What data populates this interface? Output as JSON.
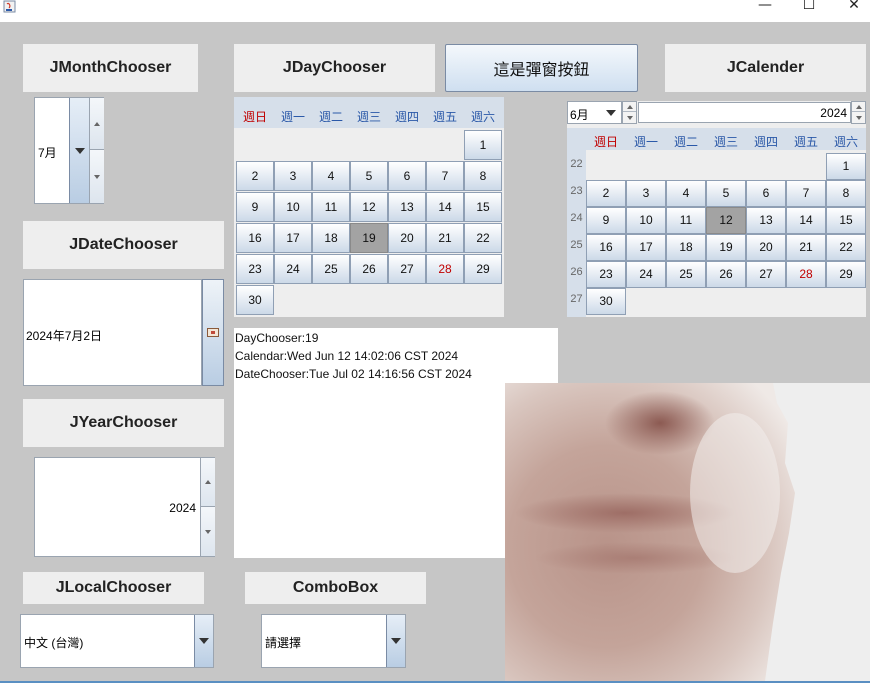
{
  "window": {
    "minimize": "—",
    "maximize": "☐",
    "close": "✕"
  },
  "headers": {
    "month_chooser": "JMonthChooser",
    "day_chooser": "JDayChooser",
    "popup_button": "這是彈窗按鈕",
    "calendar": "JCalender",
    "date_chooser": "JDateChooser",
    "year_chooser": "JYearChooser",
    "locale_chooser": "JLocalChooser",
    "combo_box": "ComboBox"
  },
  "month_chooser": {
    "value": "7月"
  },
  "date_chooser": {
    "value": "2024年7月2日"
  },
  "year_chooser": {
    "value": "2024"
  },
  "locale_chooser": {
    "value": "中文 (台灣)"
  },
  "combo_box": {
    "value": "請選擇"
  },
  "weekdays": [
    "週日",
    "週一",
    "週二",
    "週三",
    "週四",
    "週五",
    "週六"
  ],
  "day_chooser": {
    "first_weekday": 6,
    "days_in_month": 30,
    "selected": 19,
    "red_days": [
      28
    ]
  },
  "log": {
    "line1": "DayChooser:19",
    "line2": "Calendar:Wed Jun 12 14:02:06 CST 2024",
    "line3": "DateChooser:Tue Jul 02 14:16:56 CST 2024"
  },
  "calendar": {
    "month": "6月",
    "year": "2024",
    "first_weekday": 6,
    "days_in_month": 30,
    "selected": 12,
    "red_days": [
      28
    ],
    "week_numbers": [
      "22",
      "23",
      "24",
      "25",
      "26",
      "27"
    ]
  },
  "colors": {
    "background": "#c6c6c6",
    "panel": "#eeeeee",
    "weekday_header": "#d6dfea",
    "sunday": "#c00000",
    "weekday": "#2a58a8",
    "selected_day": "#a3a3a3"
  }
}
